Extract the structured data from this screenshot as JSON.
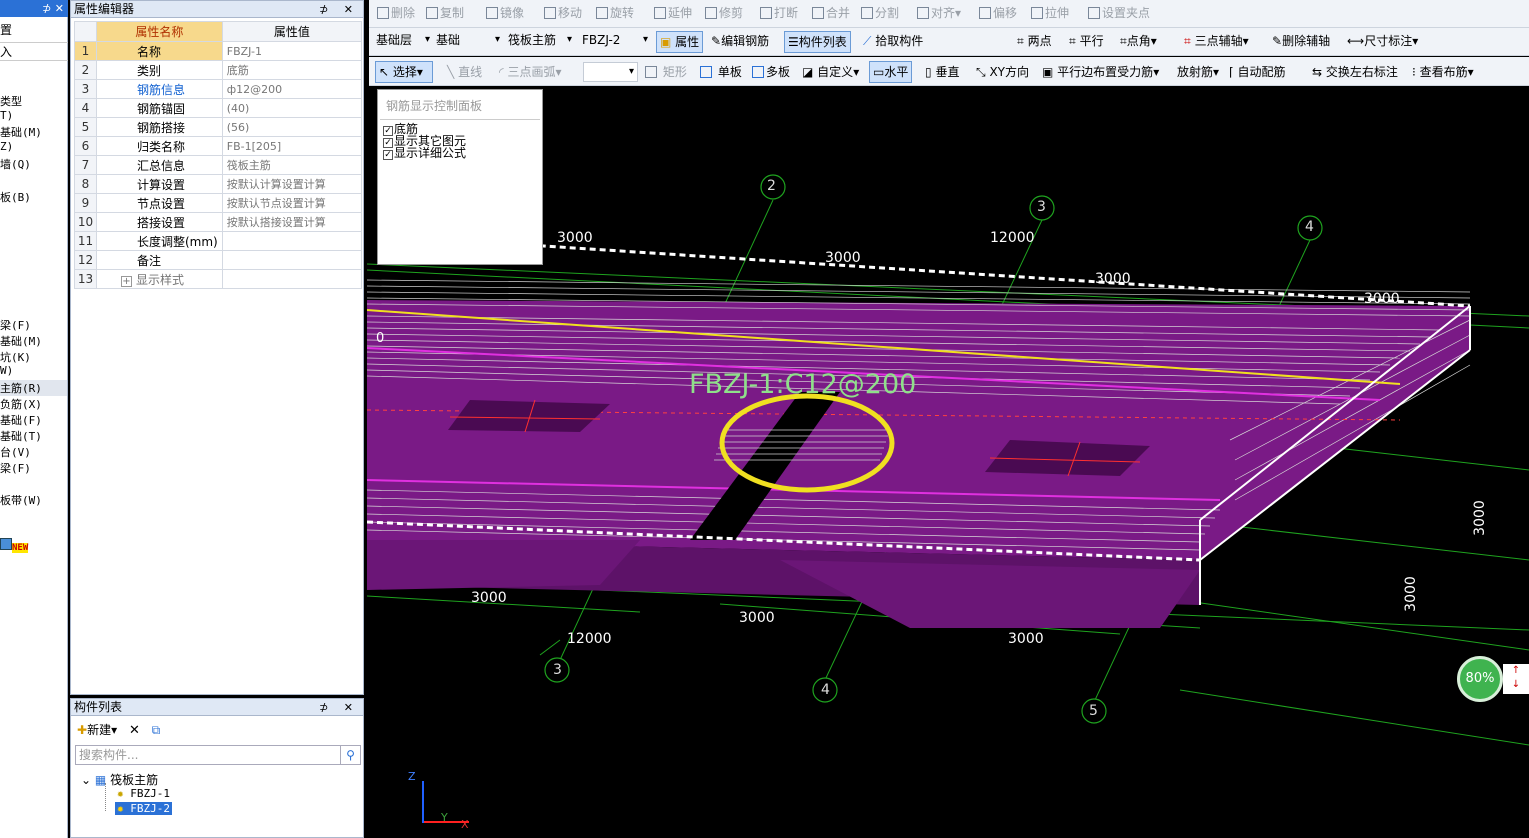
{
  "left_strip": {
    "top": [
      "置",
      "入"
    ],
    "items": [
      "类型",
      "T)",
      "基础(M)",
      "Z)",
      "墙(Q)",
      "板(B)",
      "梁(F)",
      "基础(M)",
      "坑(K)",
      "W)",
      "主筋(R)",
      "负筋(X)",
      "基础(F)",
      "基础(T)",
      "台(V)",
      "梁(F)",
      "板带(W)"
    ],
    "new_badge": "NEW"
  },
  "prop_panel": {
    "title": "属性编辑器",
    "pin": "⊅ ✕",
    "headers": [
      "属性名称",
      "属性值"
    ],
    "rows": [
      {
        "n": "1",
        "name": "名称",
        "value": "FBZJ-1"
      },
      {
        "n": "2",
        "name": "类别",
        "value": "底筋"
      },
      {
        "n": "3",
        "name": "钢筋信息",
        "value": "ф12@200"
      },
      {
        "n": "4",
        "name": "钢筋锚固",
        "value": "(40)"
      },
      {
        "n": "5",
        "name": "钢筋搭接",
        "value": "(56)"
      },
      {
        "n": "6",
        "name": "归类名称",
        "value": "FB-1[205]"
      },
      {
        "n": "7",
        "name": "汇总信息",
        "value": "筏板主筋"
      },
      {
        "n": "8",
        "name": "计算设置",
        "value": "按默认计算设置计算"
      },
      {
        "n": "9",
        "name": "节点设置",
        "value": "按默认节点设置计算"
      },
      {
        "n": "10",
        "name": "搭接设置",
        "value": "按默认搭接设置计算"
      },
      {
        "n": "11",
        "name": "长度调整(mm)",
        "value": ""
      },
      {
        "n": "12",
        "name": "备注",
        "value": ""
      },
      {
        "n": "13",
        "name": "显示样式",
        "value": ""
      }
    ],
    "expand": "+"
  },
  "comp_list": {
    "title": "构件列表",
    "pin": "⊅ ✕",
    "new_label": "新建",
    "search_placeholder": "搜索构件...",
    "tree_root": "筏板主筋",
    "items": [
      "FBZJ-1",
      "FBZJ-2"
    ]
  },
  "toolbar1": [
    "删除",
    "复制",
    "镜像",
    "移动",
    "旋转",
    "延伸",
    "修剪",
    "打断",
    "合并",
    "分割",
    "对齐",
    "偏移",
    "拉伸",
    "设置夹点"
  ],
  "toolbar2": {
    "combos": [
      "基础层",
      "基础",
      "筏板主筋",
      "FBZJ-2"
    ],
    "buttons": [
      "属性",
      "编辑钢筋",
      "构件列表",
      "拾取构件",
      "两点",
      "平行",
      "点角",
      "三点辅轴",
      "删除辅轴",
      "尺寸标注"
    ]
  },
  "toolbar3": [
    "选择",
    "直线",
    "三点画弧",
    "矩形",
    "单板",
    "多板",
    "自定义",
    "水平",
    "垂直",
    "XY方向",
    "平行边布置受力筋",
    "放射筋",
    "自动配筋",
    "交换左右标注",
    "查看布筋"
  ],
  "rebar_panel": {
    "title": "钢筋显示控制面板",
    "options": [
      {
        "label": "底筋",
        "checked": true
      },
      {
        "label": "显示其它图元",
        "checked": true
      },
      {
        "label": "显示详细公式",
        "checked": true
      }
    ]
  },
  "viewport": {
    "rebar_label": "FBZJ-1:C12@200",
    "axes": [
      "2",
      "3",
      "4",
      "3",
      "4",
      "5"
    ],
    "dims": [
      "3000",
      "12000",
      "3000",
      "3000",
      "3000",
      "3000",
      "12000",
      "3000",
      "3000",
      "3000",
      "3000",
      "0"
    ],
    "zoom": "80%",
    "axis_z": "Z",
    "axis_y": "Y",
    "axis_x": "X"
  },
  "colors": {
    "slab": "#7a1a86",
    "grid": "#1fa31f",
    "label": "#8fe08a",
    "highlight": "#f0e020"
  }
}
